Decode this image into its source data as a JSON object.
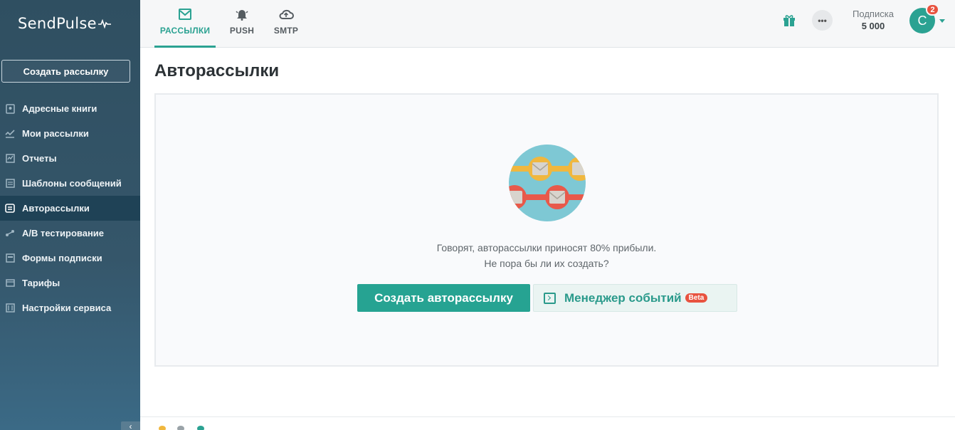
{
  "sidebar": {
    "logo": "SendPulse",
    "create_button": "Создать рассылку",
    "items": [
      {
        "label": "Адресные книги",
        "icon": "address-book-icon"
      },
      {
        "label": "Мои рассылки",
        "icon": "campaigns-icon"
      },
      {
        "label": "Отчеты",
        "icon": "reports-icon"
      },
      {
        "label": "Шаблоны сообщений",
        "icon": "templates-icon"
      },
      {
        "label": "Авторассылки",
        "icon": "automation-icon",
        "active": true
      },
      {
        "label": "A/B тестирование",
        "icon": "ab-test-icon"
      },
      {
        "label": "Формы подписки",
        "icon": "forms-icon"
      },
      {
        "label": "Тарифы",
        "icon": "pricing-icon"
      },
      {
        "label": "Настройки сервиса",
        "icon": "settings-icon"
      }
    ]
  },
  "topbar": {
    "tabs": [
      {
        "label": "РАССЫЛКИ",
        "icon": "email-icon",
        "active": true
      },
      {
        "label": "PUSH",
        "icon": "bell-icon"
      },
      {
        "label": "SMTP",
        "icon": "cloud-upload-icon"
      }
    ],
    "subscription_label": "Подписка",
    "subscription_value": "5 000",
    "avatar_letter": "C",
    "notification_count": "2"
  },
  "main": {
    "title": "Авторассылки",
    "message_line1": "Говорят, авторассылки приносят 80% прибыли.",
    "message_line2": "Не пора бы ли их создать?",
    "create_button": "Создать авторассылку",
    "events_button": "Менеджер событий",
    "beta_label": "Beta"
  },
  "colors": {
    "accent": "#2ba292",
    "sidebar": "#2f4f61",
    "badge": "#e8523f"
  }
}
